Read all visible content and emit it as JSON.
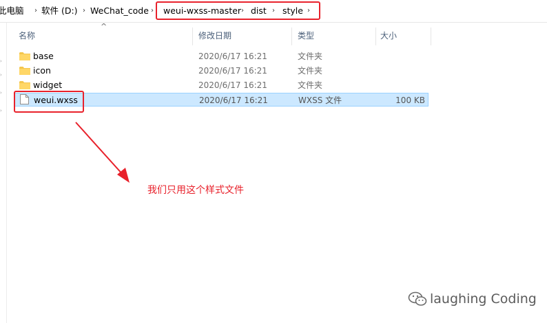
{
  "breadcrumb": {
    "items": [
      "此电脑",
      "软件 (D:)",
      "WeChat_code",
      "weui-wxss-master",
      "dist",
      "style"
    ],
    "separator": "›"
  },
  "columns": {
    "name": "名称",
    "modified": "修改日期",
    "type": "类型",
    "size": "大小"
  },
  "files": [
    {
      "name": "base",
      "modified": "2020/6/17 16:21",
      "type": "文件夹",
      "size": "",
      "icon": "folder-icon",
      "selected": false
    },
    {
      "name": "icon",
      "modified": "2020/6/17 16:21",
      "type": "文件夹",
      "size": "",
      "icon": "folder-icon",
      "selected": false
    },
    {
      "name": "widget",
      "modified": "2020/6/17 16:21",
      "type": "文件夹",
      "size": "",
      "icon": "folder-icon",
      "selected": false
    },
    {
      "name": "weui.wxss",
      "modified": "2020/6/17 16:21",
      "type": "WXSS 文件",
      "size": "100 KB",
      "icon": "file-icon",
      "selected": true
    }
  ],
  "annotation": "我们只用这个样式文件",
  "watermark": "laughing Coding",
  "colors": {
    "highlight": "#e8212b",
    "selection_bg": "#cce8ff",
    "selection_border": "#99d1ff",
    "folder": "#f4c64d",
    "header_text": "#4c607a"
  }
}
